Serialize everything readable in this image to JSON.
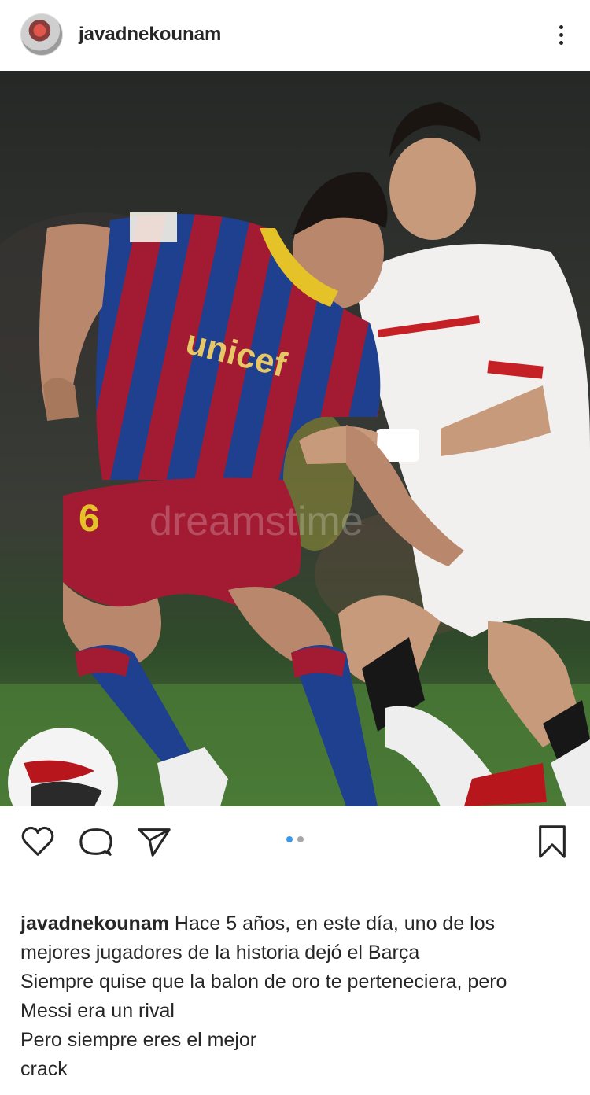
{
  "header": {
    "username": "javadnekounam",
    "avatar_icon": "profile-avatar",
    "more_icon": "more-vertical-icon"
  },
  "photo": {
    "watermark": "dreamstime",
    "sponsor_text": "unicef",
    "player_number": "6"
  },
  "actions": {
    "like_icon": "heart-icon",
    "comment_icon": "comment-icon",
    "share_icon": "send-icon",
    "save_icon": "bookmark-icon",
    "carousel": {
      "total": 2,
      "active_index": 0
    }
  },
  "caption": {
    "username": "javadnekounam",
    "lines": [
      "Hace 5 años, en este día, uno de los",
      "mejores jugadores de la historia dejó el Barça",
      "Siempre quise que la balon de oro te perteneciera, pero",
      "Messi era un rival",
      "Pero siempre eres el mejor",
      "crack"
    ]
  },
  "colors": {
    "accent_blue": "#3897f0",
    "text": "#262626",
    "barca_blue": "#1f3f8f",
    "barca_red": "#a31b33",
    "pitch_green": "#3f6b2e"
  }
}
